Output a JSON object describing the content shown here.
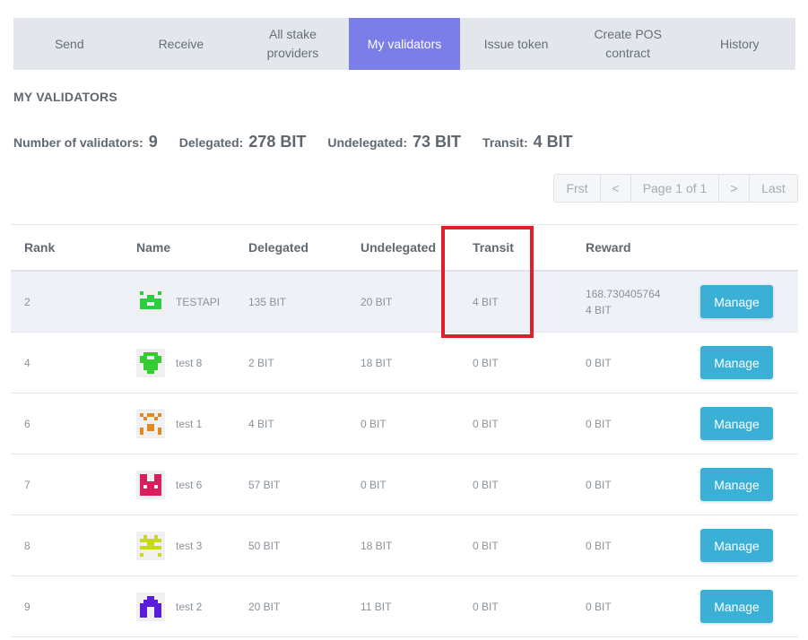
{
  "tabs": [
    {
      "label": "Send",
      "active": false
    },
    {
      "label": "Receive",
      "active": false
    },
    {
      "label": "All stake providers",
      "active": false
    },
    {
      "label": "My validators",
      "active": true
    },
    {
      "label": "Issue token",
      "active": false
    },
    {
      "label": "Create POS contract",
      "active": false
    },
    {
      "label": "History",
      "active": false
    }
  ],
  "section_title": "MY VALIDATORS",
  "stats": {
    "validators_label": "Number of validators:",
    "validators_value": "9",
    "delegated_label": "Delegated:",
    "delegated_value": "278 BIT",
    "undelegated_label": "Undelegated:",
    "undelegated_value": "73 BIT",
    "transit_label": "Transit:",
    "transit_value": "4 BIT"
  },
  "pager": {
    "first": "Frst",
    "prev": "<",
    "info": "Page 1 of 1",
    "next": ">",
    "last": "Last"
  },
  "table": {
    "headers": {
      "rank": "Rank",
      "name": "Name",
      "delegated": "Delegated",
      "undelegated": "Undelegated",
      "transit": "Transit",
      "reward": "Reward"
    },
    "rows": [
      {
        "rank": "2",
        "name": "TESTAPI",
        "delegated": "135 BIT",
        "undelegated": "20 BIT",
        "transit": "4 BIT",
        "reward_1": "168.730405764",
        "reward_2": "4 BIT",
        "action": "Manage",
        "avatar_color": "#2ecc40",
        "highlight": true
      },
      {
        "rank": "4",
        "name": "test 8",
        "delegated": "2 BIT",
        "undelegated": "18 BIT",
        "transit": "0 BIT",
        "reward_1": "0 BIT",
        "reward_2": "",
        "action": "Manage",
        "avatar_color": "#33cc33",
        "highlight": false
      },
      {
        "rank": "6",
        "name": "test 1",
        "delegated": "4 BIT",
        "undelegated": "0 BIT",
        "transit": "0 BIT",
        "reward_1": "0 BIT",
        "reward_2": "",
        "action": "Manage",
        "avatar_color": "#e08a1e",
        "highlight": false
      },
      {
        "rank": "7",
        "name": "test 6",
        "delegated": "57 BIT",
        "undelegated": "0 BIT",
        "transit": "0 BIT",
        "reward_1": "0 BIT",
        "reward_2": "",
        "action": "Manage",
        "avatar_color": "#d81e5b",
        "highlight": false
      },
      {
        "rank": "8",
        "name": "test 3",
        "delegated": "50 BIT",
        "undelegated": "18 BIT",
        "transit": "0 BIT",
        "reward_1": "0 BIT",
        "reward_2": "",
        "action": "Manage",
        "avatar_color": "#c8d81e",
        "highlight": false
      },
      {
        "rank": "9",
        "name": "test 2",
        "delegated": "20 BIT",
        "undelegated": "11 BIT",
        "transit": "0 BIT",
        "reward_1": "0 BIT",
        "reward_2": "",
        "action": "Manage",
        "avatar_color": "#5b1ed8",
        "highlight": false
      }
    ]
  },
  "colors": {
    "tab_active": "#7c7ee8",
    "tab_bg": "#e3e7ec",
    "button": "#3bb0d6",
    "callout": "#e02028"
  }
}
